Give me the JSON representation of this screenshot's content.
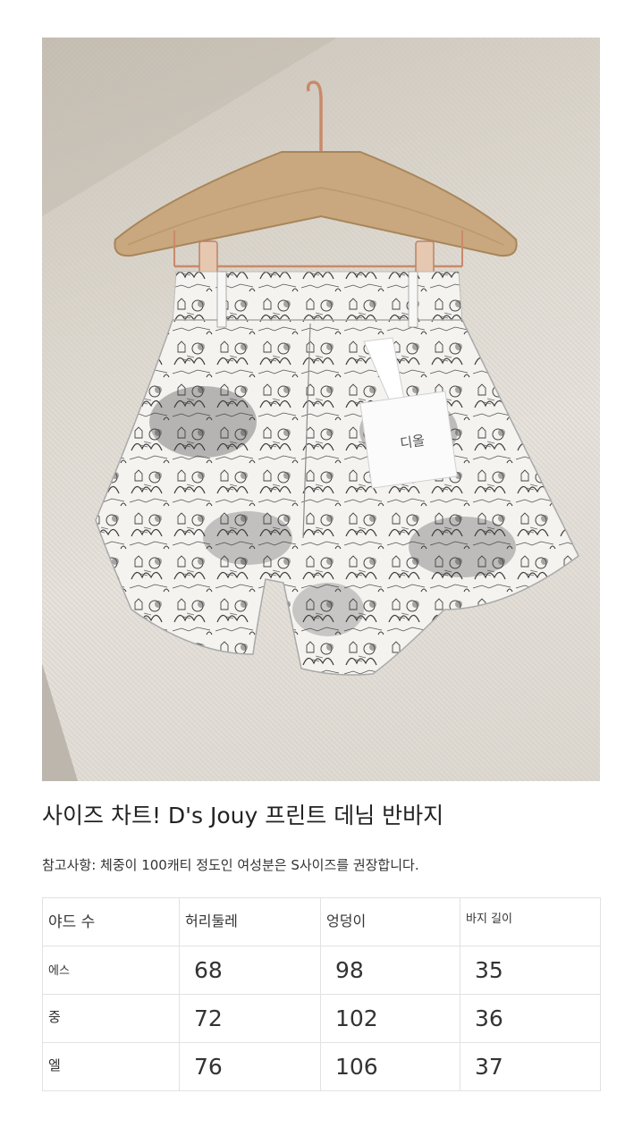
{
  "product": {
    "title": "사이즈 차트! D's Jouy 프린트 데님 반바지",
    "note": "참고사항: 체중이 100캐티 정도인 여성분은 S사이즈를 권장합니다.",
    "tag_text": "디올"
  },
  "size_table": {
    "headers": [
      "야드 수",
      "허리둘레",
      "엉덩이",
      "바지 길이"
    ],
    "rows": [
      {
        "size": "에스",
        "waist": "68",
        "hip": "98",
        "length": "35"
      },
      {
        "size": "중",
        "waist": "72",
        "hip": "102",
        "length": "36"
      },
      {
        "size": "엘",
        "waist": "76",
        "hip": "106",
        "length": "37"
      }
    ]
  },
  "colors": {
    "background": "#ffffff",
    "text": "#222222",
    "table_border": "#e2e2e2",
    "hanger_wood": "#c9a77f",
    "hanger_metal": "#c9896a",
    "fabric_base": "#f4f3f0",
    "fabric_print": "#3a3a3a"
  }
}
